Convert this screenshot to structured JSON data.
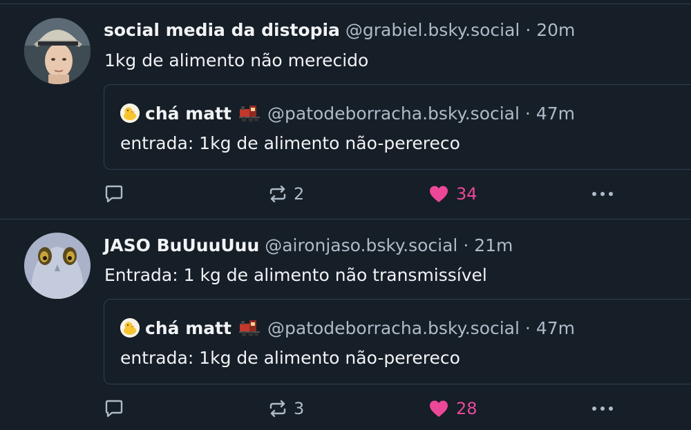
{
  "posts": [
    {
      "author": {
        "display_name": "social media da distopia",
        "handle": "@grabiel.bsky.social",
        "avatar_icon": "avatar-photo-person-hat"
      },
      "separator": " · ",
      "time": "20m",
      "text": "1kg de alimento não merecido",
      "quote": {
        "author": {
          "display_name": "chá matt",
          "name_emoji": "steam-locomotive-emoji",
          "handle": "@patodeborracha.bsky.social",
          "avatar_icon": "rubber-duck-avatar"
        },
        "separator": " · ",
        "time": "47m",
        "text": "entrada: 1kg de alimento não-perereco"
      },
      "actions": {
        "reply_count": "",
        "repost_count": "2",
        "like_count": "34",
        "liked": true
      }
    },
    {
      "author": {
        "display_name": "JASO BuUuuUuu",
        "handle": "@aironjaso.bsky.social",
        "avatar_icon": "avatar-ghost"
      },
      "separator": " · ",
      "time": "21m",
      "text": "Entrada: 1 kg de alimento não transmissível",
      "quote": {
        "author": {
          "display_name": "chá matt",
          "name_emoji": "steam-locomotive-emoji",
          "handle": "@patodeborracha.bsky.social",
          "avatar_icon": "rubber-duck-avatar"
        },
        "separator": " · ",
        "time": "47m",
        "text": "entrada: 1kg de alimento não-perereco"
      },
      "actions": {
        "reply_count": "",
        "repost_count": "3",
        "like_count": "28",
        "liked": true
      }
    }
  ],
  "colors": {
    "background": "#161e27",
    "border": "#2e4052",
    "text_primary": "#f1f3f5",
    "text_secondary": "#aebbc9",
    "like_active": "#ec4899"
  }
}
